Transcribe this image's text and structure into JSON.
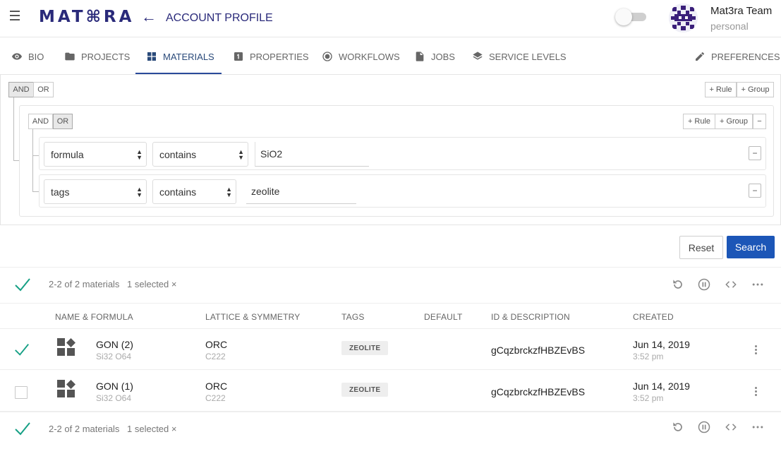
{
  "header": {
    "logo": "MAT⌘RA",
    "title": "ACCOUNT PROFILE",
    "user_name": "Mat3ra Team",
    "user_sub": "personal"
  },
  "tabs": [
    {
      "label": "BIO",
      "icon": "eye-icon"
    },
    {
      "label": "PROJECTS",
      "icon": "folder-icon"
    },
    {
      "label": "MATERIALS",
      "icon": "dashboard-icon",
      "active": true
    },
    {
      "label": "PROPERTIES",
      "icon": "number-one-icon"
    },
    {
      "label": "WORKFLOWS",
      "icon": "radio-button-icon"
    },
    {
      "label": "JOBS",
      "icon": "file-icon"
    },
    {
      "label": "SERVICE LEVELS",
      "icon": "layers-icon"
    },
    {
      "label": "PREFERENCES",
      "icon": "pencil-icon"
    }
  ],
  "query": {
    "outer_and": "AND",
    "outer_or": "OR",
    "outer_add_rule": "+ Rule",
    "outer_add_group": "+ Group",
    "inner_and": "AND",
    "inner_or": "OR",
    "inner_add_rule": "+ Rule",
    "inner_add_group": "+ Group",
    "remove": "−",
    "rules": [
      {
        "field": "formula",
        "operator": "contains",
        "value": "SiO2"
      },
      {
        "field": "tags",
        "operator": "contains",
        "value": "zeolite"
      }
    ]
  },
  "actions": {
    "reset": "Reset",
    "search": "Search"
  },
  "table": {
    "count_label": "2-2 of 2 materials",
    "selected_label": "1 selected ×",
    "headers": [
      "NAME & FORMULA",
      "LATTICE & SYMMETRY",
      "TAGS",
      "DEFAULT",
      "ID & DESCRIPTION",
      "CREATED"
    ],
    "rows": [
      {
        "name": "GON (2)",
        "formula": "Si32 O64",
        "lattice": "ORC",
        "symmetry": "C222",
        "tag": "ZEOLITE",
        "id": "gCqzbrckzfHBZEvBS",
        "date": "Jun 14, 2019",
        "time": "3:52 pm",
        "selected": true
      },
      {
        "name": "GON (1)",
        "formula": "Si32 O64",
        "lattice": "ORC",
        "symmetry": "C222",
        "tag": "ZEOLITE",
        "id": "gCqzbrckzfHBZEvBS",
        "date": "Jun 14, 2019",
        "time": "3:52 pm",
        "selected": false
      }
    ]
  },
  "colors": {
    "brand": "#2a2a7a",
    "accent": "#1c56b7",
    "check": "#16a085"
  }
}
